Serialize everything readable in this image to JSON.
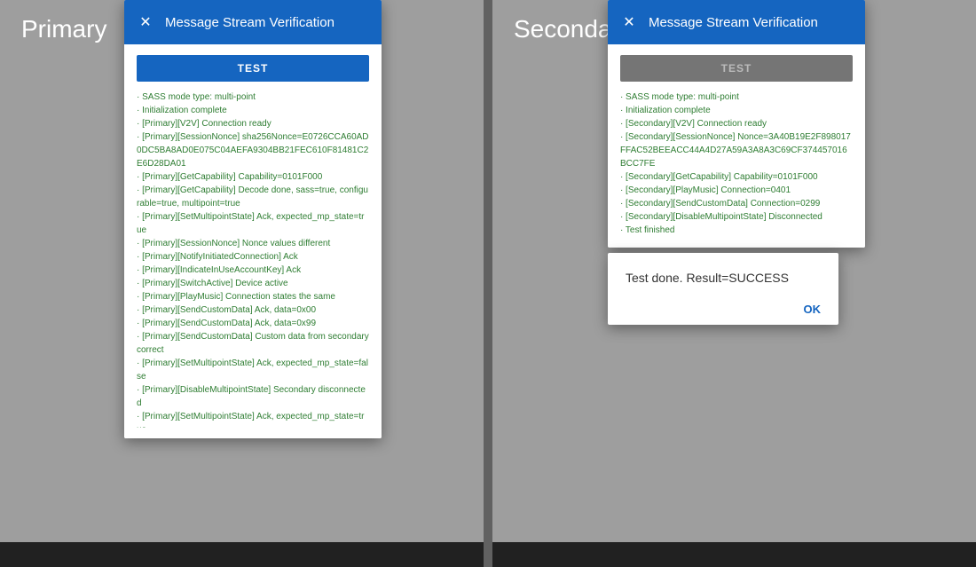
{
  "primary": {
    "label": "Primary",
    "dialog": {
      "title": "Message Stream Verification",
      "test_button": "TEST",
      "log": "· SASS mode type: multi-point\n· Initialization complete\n· [Primary][V2V] Connection ready\n· [Primary][SessionNonce] sha256Nonce=E0726CCA60AD0DC5BA8AD0E075C04AEFA9304BB21FEC610F81481C2E6D28DA01\n· [Primary][GetCapability] Capability=0101F000\n· [Primary][GetCapability] Decode done, sass=true, configurable=true, multipoint=true\n· [Primary][SetMultipointState] Ack, expected_mp_state=true\n· [Primary][SessionNonce] Nonce values different\n· [Primary][NotifyInitiatedConnection] Ack\n· [Primary][IndicateInUseAccountKey] Ack\n· [Primary][SwitchActive] Device active\n· [Primary][PlayMusic] Connection states the same\n· [Primary][SendCustomData] Ack, data=0x00\n· [Primary][SendCustomData] Ack, data=0x99\n· [Primary][SendCustomData] Custom data from secondary correct\n· [Primary][SetMultipointState] Ack, expected_mp_state=false\n· [Primary][DisableMultipointState] Secondary disconnected\n· [Primary][SetMultipointState] Ack, expected_mp_state=true\n· Test finished"
    }
  },
  "secondary": {
    "label": "Secondary",
    "dialog": {
      "title": "Message Stream Verification",
      "test_button": "TEST",
      "log": "· SASS mode type: multi-point\n· Initialization complete\n· [Secondary][V2V] Connection ready\n· [Secondary][SessionNonce] Nonce=3A40B19E2F898017FFAC52BEEACC44A4D27A59A3A8A3C69CF374457016BCC7FE\n· [Secondary][GetCapability] Capability=0101F000\n· [Secondary][PlayMusic] Connection=0401\n· [Secondary][SendCustomData] Connection=0299\n· [Secondary][DisableMultipointState] Disconnected\n· Test finished"
    },
    "result_dialog": {
      "text": "Test done. Result=SUCCESS",
      "ok_label": "OK"
    }
  },
  "icons": {
    "close": "✕"
  }
}
